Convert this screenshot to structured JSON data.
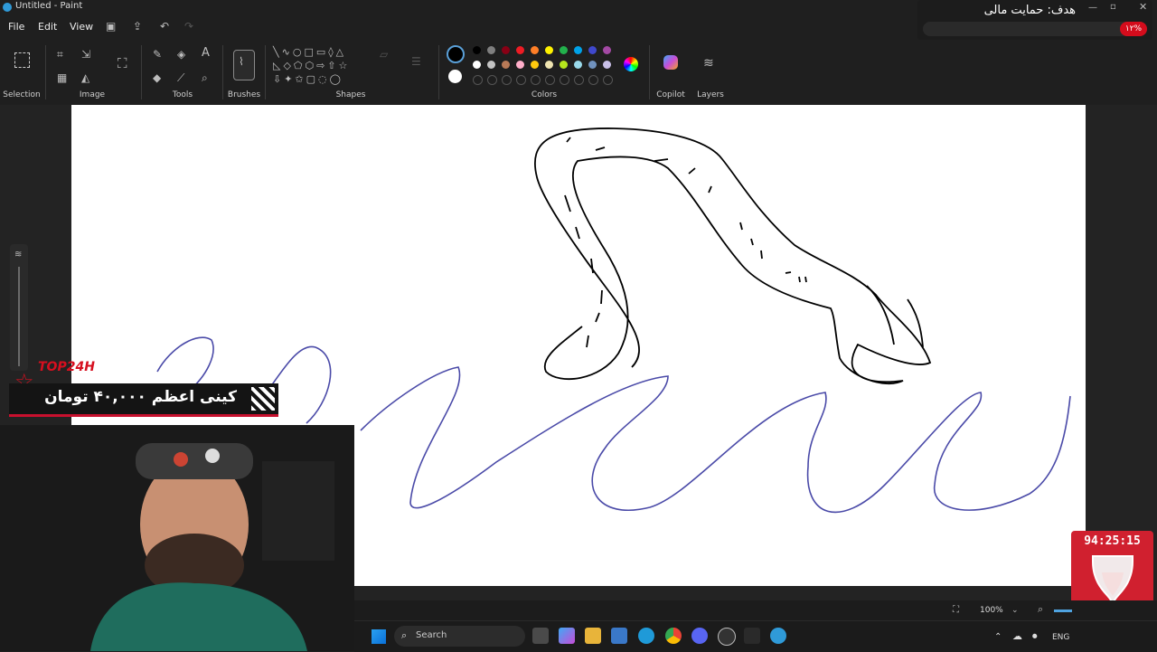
{
  "window": {
    "title": "Untitled - Paint"
  },
  "menu": {
    "file": "File",
    "edit": "Edit",
    "view": "View"
  },
  "ribbon": {
    "groups": {
      "selection": "Selection",
      "image": "Image",
      "tools": "Tools",
      "brushes": "Brushes",
      "shapes": "Shapes",
      "colors": "Colors",
      "copilot": "Copilot",
      "layers": "Layers"
    },
    "palette_row1": [
      "#000000",
      "#7f7f7f",
      "#880015",
      "#ed1c24",
      "#ff7f27",
      "#fff200",
      "#22b14c",
      "#00a2e8",
      "#3f48cc",
      "#a349a4"
    ],
    "palette_row2": [
      "#ffffff",
      "#c3c3c3",
      "#b97a57",
      "#ffaec9",
      "#ffc90e",
      "#efe4b0",
      "#b5e61d",
      "#99d9ea",
      "#7092be",
      "#c8bfe7"
    ],
    "primary_color": "#000000",
    "secondary_color": "#ffffff"
  },
  "overlay": {
    "goal_title": "هدف: حمایت مالی",
    "goal_percent": "۱۲%",
    "brand": "TOP24H",
    "banner_text": "کینی اعظم   ۴۰,۰۰۰ تومان",
    "timer": "94:25:15"
  },
  "status": {
    "zoom": "100%"
  },
  "taskbar": {
    "search_placeholder": "Search",
    "lang": "ENG"
  },
  "colors": {
    "canvas_bg": "#ffffff",
    "wave_stroke": "#4a4aa8",
    "snake_stroke": "#000000",
    "accent_red": "#d40c1c"
  }
}
